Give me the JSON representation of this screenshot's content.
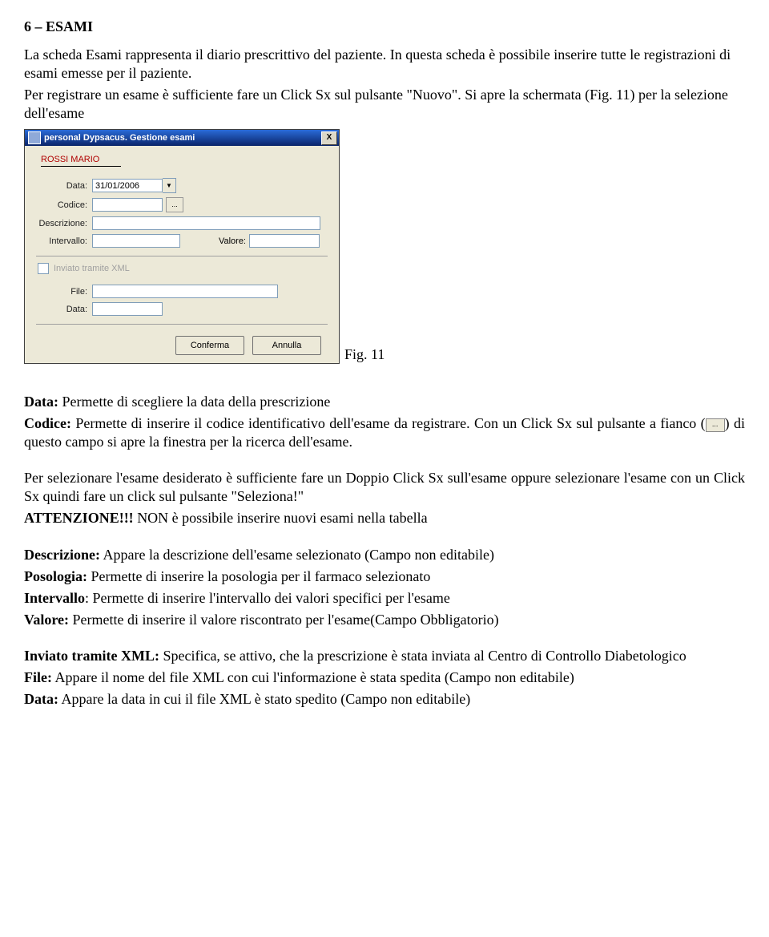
{
  "section_heading": "6 – ESAMI",
  "intro1": "La scheda Esami rappresenta il diario prescrittivo del paziente. In questa scheda è possibile inserire tutte le registrazioni di esami emesse per il paziente.",
  "intro2": "Per registrare un esame è sufficiente fare un Click Sx sul pulsante \"Nuovo\". Si apre la schermata (Fig. 11) per la selezione dell'esame",
  "dialog": {
    "title": "personal Dypsacus. Gestione esami",
    "patient": "ROSSI MARIO",
    "labels": {
      "data": "Data:",
      "codice": "Codice:",
      "descrizione": "Descrizione:",
      "intervallo": "Intervallo:",
      "valore": "Valore:",
      "file": "File:",
      "data2": "Data:"
    },
    "date_value": "31/01/2006",
    "xml_label": "Inviato tramite XML",
    "btn_ok": "Conferma",
    "btn_cancel": "Annulla",
    "close": "X",
    "dots": "...",
    "chevron": "▼"
  },
  "fig_caption": "Fig. 11",
  "para_data_lbl": "Data:",
  "para_data": " Permette di scegliere la data della prescrizione",
  "para_codice_lbl": "Codice:",
  "para_codice": " Permette di inserire il codice identificativo dell'esame da registrare. Con un Click Sx sul pulsante a fianco (",
  "para_codice_tail": ") di questo campo si apre la finestra per la ricerca dell'esame.",
  "para_sel": "Per selezionare l'esame desiderato è sufficiente fare un Doppio Click Sx sull'esame oppure selezionare l'esame con un Click Sx quindi fare un click sul pulsante \"Seleziona!\"",
  "para_att_lbl": "ATTENZIONE!!!",
  "para_att": " NON è possibile inserire nuovi esami nella tabella",
  "para_desc_lbl": "Descrizione:",
  "para_desc": " Appare la descrizione dell'esame selezionato (Campo non editabile)",
  "para_pos_lbl": "Posologia:",
  "para_pos": " Permette di inserire la posologia per il farmaco selezionato",
  "para_int_lbl": "Intervallo",
  "para_int": ": Permette di inserire l'intervallo dei valori specifici per l'esame",
  "para_val_lbl": "Valore:",
  "para_val": " Permette di inserire il valore riscontrato per l'esame(Campo Obbligatorio)",
  "para_xml_lbl": "Inviato tramite XML:",
  "para_xml": " Specifica, se attivo, che la prescrizione è stata inviata al Centro di Controllo Diabetologico",
  "para_file_lbl": "File:",
  "para_file": " Appare il nome del file XML con cui l'informazione è stata spedita (Campo non editabile)",
  "para_data2_lbl": "Data:",
  "para_data2": " Appare la data in cui il file XML è stato spedito (Campo non editabile)"
}
